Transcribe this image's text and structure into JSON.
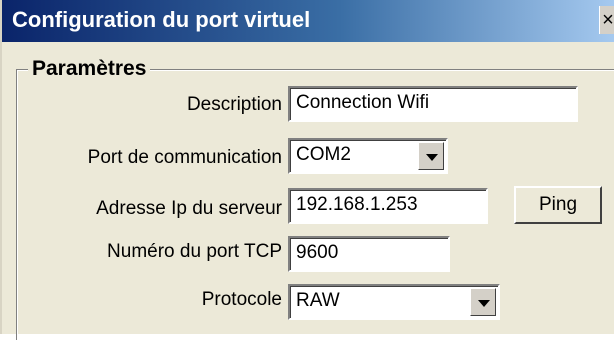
{
  "window": {
    "title": "Configuration du port virtuel",
    "close_glyph": "×"
  },
  "group": {
    "legend": "Paramètres"
  },
  "fields": {
    "description": {
      "label": "Description",
      "value": "Connection Wifi"
    },
    "port": {
      "label": "Port de communication",
      "value": "COM2"
    },
    "ip": {
      "label": "Adresse Ip du serveur",
      "value": "192.168.1.253"
    },
    "tcp_port": {
      "label": "Numéro du port TCP",
      "value": "9600"
    },
    "protocol": {
      "label": "Protocole",
      "value": "RAW"
    }
  },
  "buttons": {
    "ping": "Ping"
  },
  "icons": {
    "close": "close-icon",
    "dropdown": "chevron-down-icon"
  }
}
